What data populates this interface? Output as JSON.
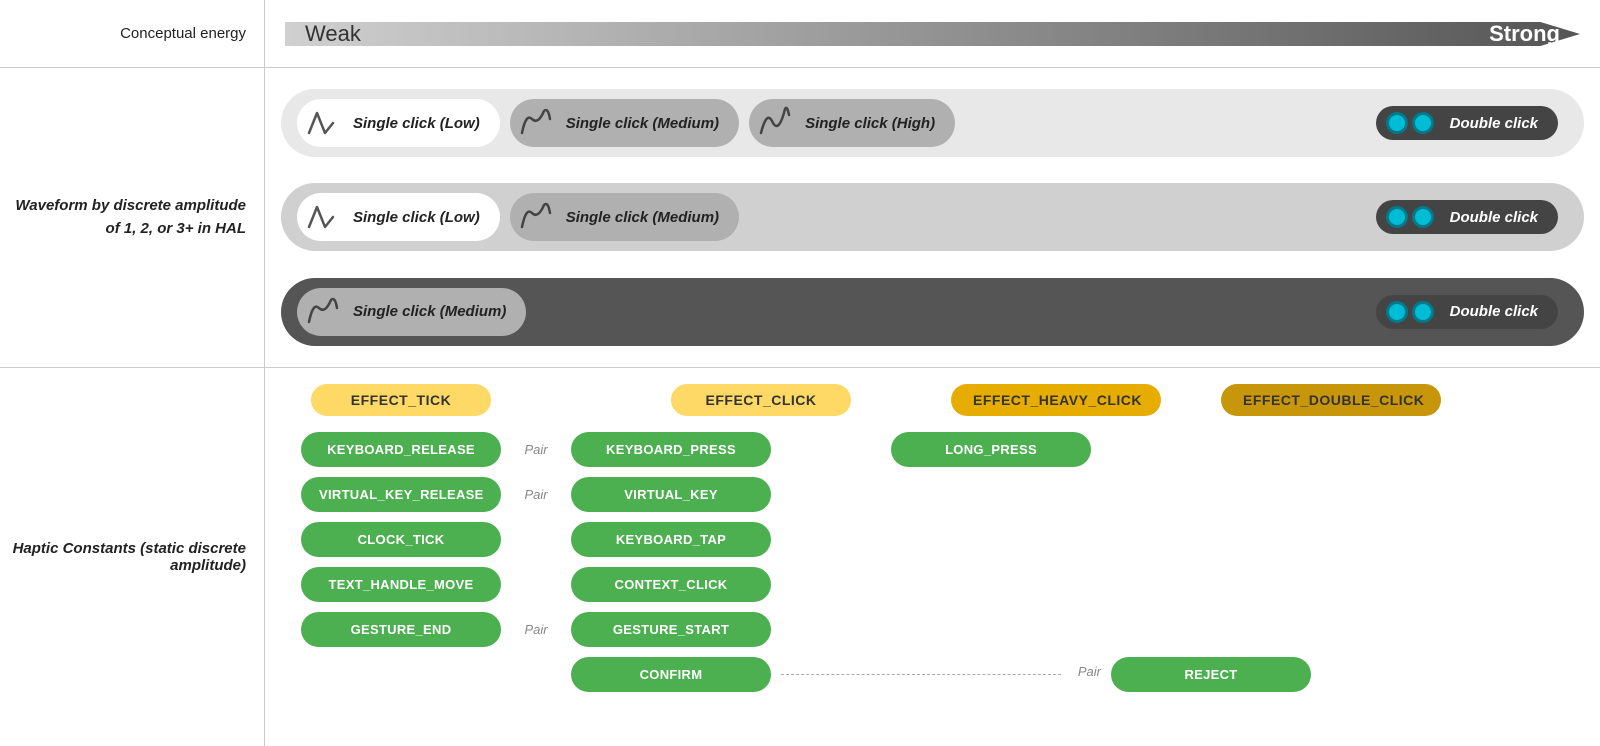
{
  "labels": {
    "conceptual_energy": "Conceptual energy",
    "weak": "Weak",
    "strong": "Strong",
    "waveform_label": "Waveform by discrete amplitude of 1, 2, or 3+ in HAL",
    "haptic_constants_label": "Haptic Constants (static discrete amplitude)"
  },
  "energy_bar": {
    "weak": "Weak",
    "strong": "Strong"
  },
  "waveform_strips": [
    {
      "style": "light",
      "pills": [
        {
          "type": "white",
          "icon": "wave-low",
          "text": "Single click (Low)"
        },
        {
          "type": "gray",
          "icon": "wave-medium",
          "text": "Single click (Medium)"
        },
        {
          "type": "gray",
          "icon": "wave-high",
          "text": "Single click (High)"
        },
        {
          "type": "dark",
          "icon": "double-click",
          "text": "Double click"
        }
      ]
    },
    {
      "style": "medium",
      "pills": [
        {
          "type": "white",
          "icon": "wave-low",
          "text": "Single click (Low)"
        },
        {
          "type": "gray",
          "icon": "wave-medium",
          "text": "Single click (Medium)"
        },
        {
          "type": "dark",
          "icon": "double-click",
          "text": "Double click"
        }
      ]
    },
    {
      "style": "dark-gray",
      "pills": [
        {
          "type": "gray",
          "icon": "wave-medium",
          "text": "Single click (Medium)"
        },
        {
          "type": "dark",
          "icon": "double-click",
          "text": "Double click"
        }
      ]
    }
  ],
  "effect_labels": {
    "tick": "EFFECT_TICK",
    "click": "EFFECT_CLICK",
    "heavy_click": "EFFECT_HEAVY_CLICK",
    "double_click": "EFFECT_DOUBLE_CLICK"
  },
  "haptic_constants": {
    "col1": [
      {
        "label": "KEYBOARD_RELEASE",
        "pair": "Pair"
      },
      {
        "label": "VIRTUAL_KEY_RELEASE",
        "pair": "Pair"
      },
      {
        "label": "CLOCK_TICK",
        "pair": null
      },
      {
        "label": "TEXT_HANDLE_MOVE",
        "pair": null
      },
      {
        "label": "GESTURE_END",
        "pair": "Pair"
      }
    ],
    "col3": [
      {
        "label": "KEYBOARD_PRESS"
      },
      {
        "label": "VIRTUAL_KEY"
      },
      {
        "label": "KEYBOARD_TAP"
      },
      {
        "label": "CONTEXT_CLICK"
      },
      {
        "label": "GESTURE_START"
      },
      {
        "label": "CONFIRM"
      }
    ],
    "col4": [
      {
        "label": "LONG_PRESS"
      }
    ],
    "col6": [
      {
        "label": "REJECT"
      }
    ]
  },
  "pair_labels": {
    "pair": "Pair"
  }
}
